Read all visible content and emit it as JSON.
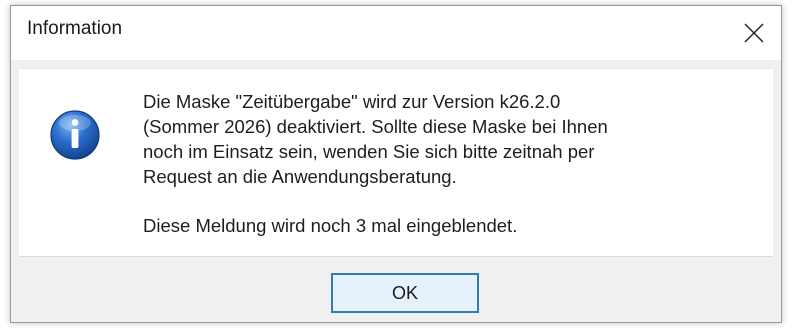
{
  "window": {
    "title": "Information"
  },
  "icons": {
    "close": "close-icon",
    "info": "information-icon"
  },
  "message": {
    "paragraph1": "Die Maske \"Zeitübergabe\" wird zur Version k26.2.0\n(Sommer 2026) deaktiviert. Sollte diese Maske bei Ihnen\nnoch im Einsatz sein, wenden Sie sich bitte zeitnah per\nRequest an die Anwendungsberatung.",
    "paragraph2": "Diese Meldung wird noch 3 mal eingeblendet."
  },
  "buttons": {
    "ok_label": "OK"
  },
  "colors": {
    "accent": "#2e7fb0",
    "icon_blue": "#1d5fb8"
  }
}
